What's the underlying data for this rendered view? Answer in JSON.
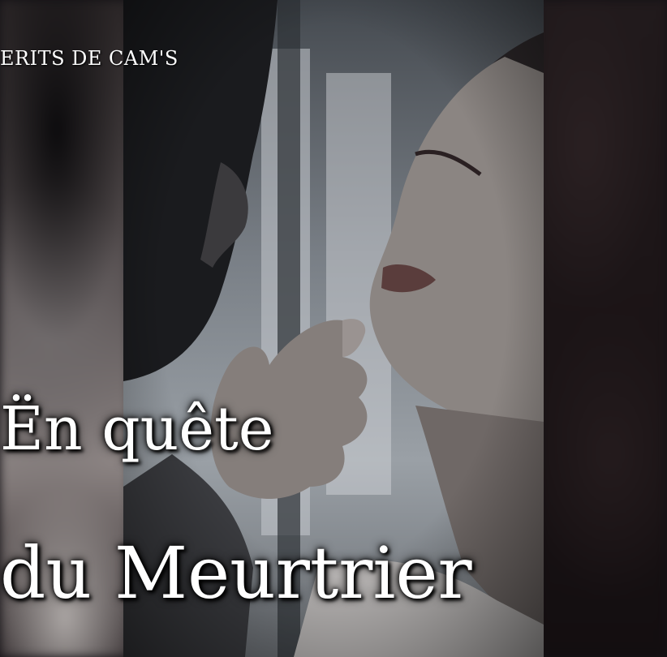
{
  "watermark": {
    "text": "ERITS DE CAM'S"
  },
  "title": {
    "line1": "Ën quête",
    "line2": "du Meurtrier"
  },
  "colors": {
    "background": "#141216",
    "text": "#ffffff",
    "shadow": "#000000"
  }
}
